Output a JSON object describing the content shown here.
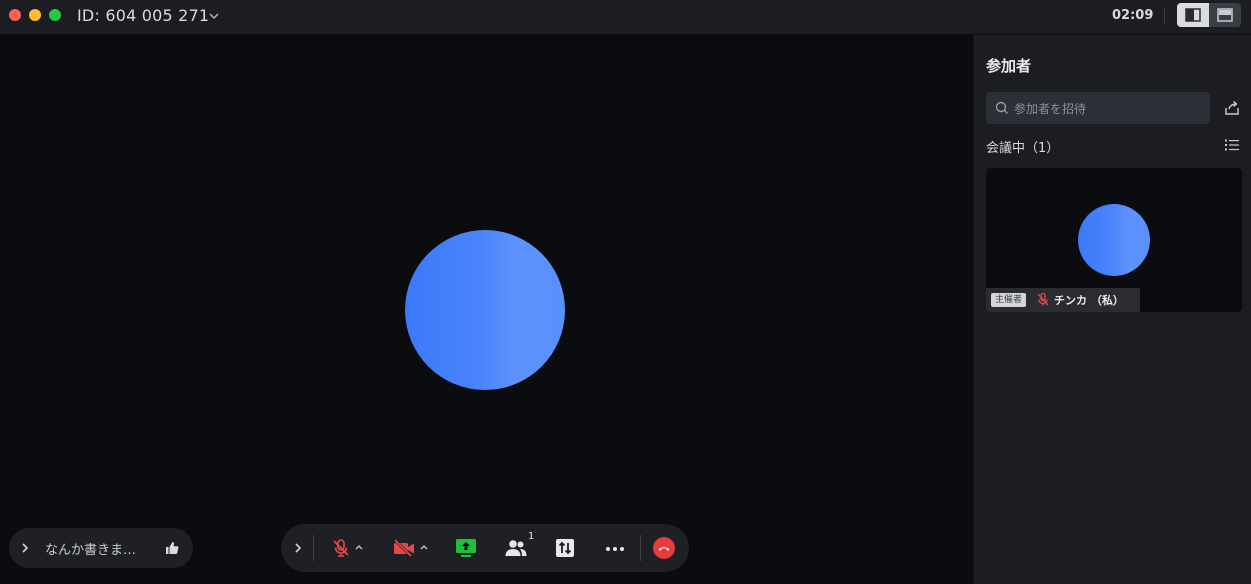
{
  "titlebar": {
    "meeting_id": "ID: 604 005 271",
    "clock": "02:09"
  },
  "chat": {
    "placeholder_text": "なんか書きま…"
  },
  "toolbar": {
    "participants_count": "1"
  },
  "sidebar": {
    "title": "参加者",
    "search_placeholder": "参加者を招待",
    "in_meeting_label": "会議中（1）",
    "participant": {
      "host_badge": "主催者",
      "name": "チンカ （私）"
    }
  },
  "colors": {
    "avatar": "#4a86fc",
    "mute_red": "#e5484d",
    "share_green": "#1fbf3a",
    "leave_red": "#e53c3c"
  }
}
